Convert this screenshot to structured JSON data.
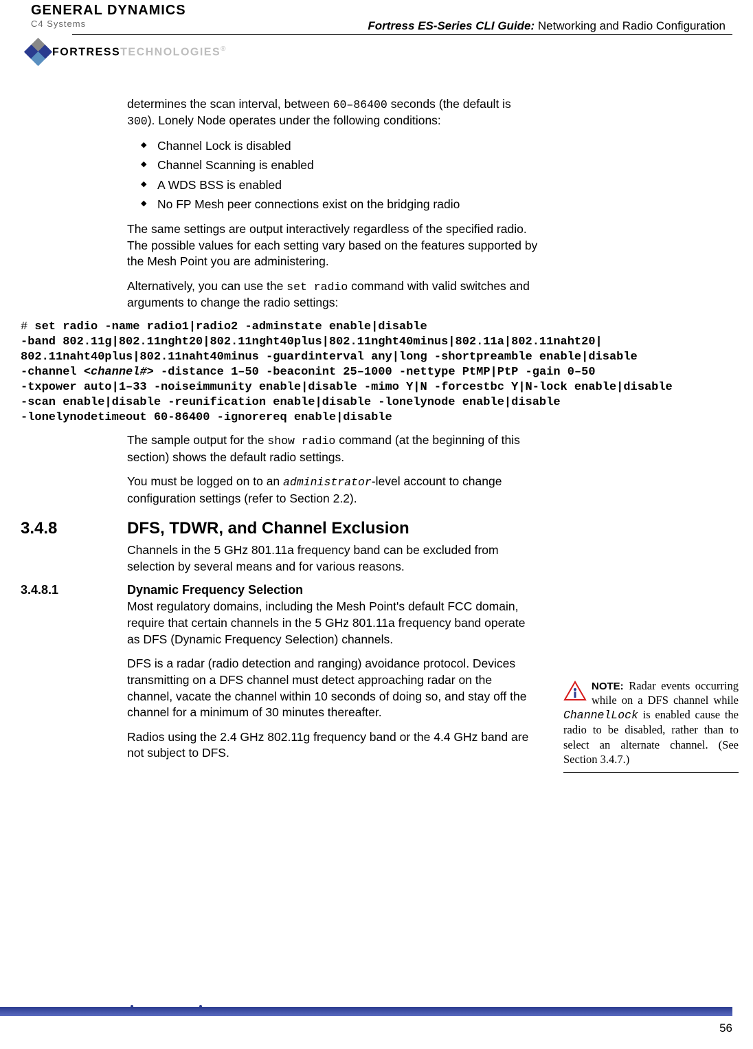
{
  "header": {
    "gd_main": "GENERAL DYNAMICS",
    "gd_sub": "C4 Systems",
    "doc_title_bold": "Fortress ES-Series CLI Guide:",
    "doc_title_rest": " Networking and Radio Configuration",
    "fortress_b": "FORTRESS",
    "fortress_g": "TECHNOLOGIES",
    "fortress_r": "®"
  },
  "intro": {
    "p1_a": "determines the scan interval, between ",
    "p1_code": "60–86400",
    "p1_b": " seconds (the default is ",
    "p1_code2": "300",
    "p1_c": "). Lonely Node operates under the following conditions:",
    "bullets": [
      "Channel Lock is disabled",
      "Channel Scanning is enabled",
      "A WDS BSS is enabled",
      "No FP Mesh peer connections exist on the bridging radio"
    ],
    "p2": "The same settings are output interactively regardless of the specified radio. The possible values for each setting vary based on the features supported by the Mesh Point you are administering.",
    "p3_a": "Alternatively, you can use the ",
    "p3_code": "set radio",
    "p3_b": " command with valid switches and arguments to change the radio settings:"
  },
  "code": {
    "prompt": "# ",
    "line1": "set radio -name radio1|radio2 -adminstate enable|disable",
    "line2": "-band 802.11g|802.11nght20|802.11nght40plus|802.11nght40minus|802.11a|802.11naht20|",
    "line3": "802.11naht40plus|802.11naht40minus -guardinterval any|long -shortpreamble enable|disable",
    "line4a": "-channel <",
    "line4arg": "channel#",
    "line4b": "> -distance 1–50 -beaconint 25–1000 -nettype PtMP|PtP -gain 0–50",
    "line5": "-txpower auto|1–33 -noiseimmunity enable|disable -mimo Y|N -forcestbc Y|N-lock enable|disable",
    "line6": "-scan enable|disable -reunification enable|disable -lonelynode enable|disable",
    "line7": "-lonelynodetimeout 60-86400 -ignorereq enable|disable"
  },
  "after_code": {
    "p1_a": "The sample output for the ",
    "p1_code": "show radio",
    "p1_b": " command (at the beginning of this section) shows the default radio settings.",
    "p2_a": "You must be logged on to an ",
    "p2_code": "administrator",
    "p2_b": "-level account to change configuration settings (refer to Section 2.2)."
  },
  "sec348": {
    "num": "3.4.8",
    "title": "DFS, TDWR, and Channel Exclusion",
    "p1": "Channels in the 5 GHz 801.11a frequency band can be excluded from selection by several means and for various reasons."
  },
  "sec3481": {
    "num": "3.4.8.1",
    "title": "Dynamic Frequency Selection",
    "p1": "Most regulatory domains, including the Mesh Point's default FCC domain, require that certain channels in the 5 GHz 801.11a frequency band operate as DFS (Dynamic Frequency Selection) channels.",
    "p2": "DFS is a radar (radio detection and ranging) avoidance protocol. Devices transmitting on a DFS channel must detect approaching radar on the channel, vacate the channel within 10 seconds of doing so, and stay off the channel for a minimum of 30 minutes thereafter.",
    "p3": "Radios using the 2.4 GHz 802.11g frequency band or the 4.4 GHz band are not subject to DFS."
  },
  "sidenote": {
    "label": "NOTE:",
    "text_a": " Radar events occurring while on a DFS channel while ",
    "code": "ChannelLock",
    "text_b": " is enabled cause the radio to be disabled, rather than to select an alternate channel. (See Section 3.4.7.)"
  },
  "page_num": "56"
}
